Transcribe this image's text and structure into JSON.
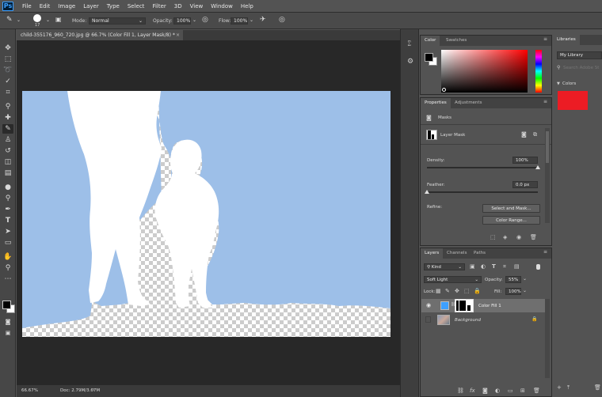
{
  "menubar": {
    "logo": "Ps",
    "items": [
      "File",
      "Edit",
      "Image",
      "Layer",
      "Type",
      "Select",
      "Filter",
      "3D",
      "View",
      "Window",
      "Help"
    ]
  },
  "options": {
    "brush_size": "17",
    "mode_label": "Mode:",
    "mode_value": "Normal",
    "opacity_label": "Opacity:",
    "opacity_value": "100%",
    "flow_label": "Flow:",
    "flow_value": "100%"
  },
  "document": {
    "tab_title": "child-355176_960_720.jpg @ 66.7% (Color Fill 1, Layer Mask/8) *",
    "close_glyph": "×",
    "zoom": "66.67%",
    "doc_size": "Doc: 2.79M/3.67M"
  },
  "color_panel": {
    "tabs": [
      "Color",
      "Swatches"
    ],
    "foreground": "#000000",
    "background": "#ffffff",
    "hue": "#ff0000"
  },
  "properties_panel": {
    "tabs": [
      "Properties",
      "Adjustments"
    ],
    "section": "Masks",
    "mask_name": "Layer Mask",
    "density_label": "Density:",
    "density_value": "100%",
    "density_level": 1.0,
    "feather_label": "Feather:",
    "feather_value": "0.0 px",
    "feather_level": 0.0,
    "refine_label": "Refine:",
    "select_mask_button": "Select and Mask...",
    "color_range_button": "Color Range..."
  },
  "layers_panel": {
    "tabs": [
      "Layers",
      "Channels",
      "Paths"
    ],
    "filter_kind": "Kind",
    "blend_mode": "Soft Light",
    "opacity_label": "Opacity:",
    "opacity_value": "55%",
    "lock_label": "Lock:",
    "fill_label": "Fill:",
    "fill_value": "100%",
    "layers": [
      {
        "name": "Color Fill 1",
        "visible": true,
        "selected": true
      },
      {
        "name": "Background",
        "visible": false,
        "selected": false,
        "locked": true
      }
    ]
  },
  "libraries_panel": {
    "title": "Libraries",
    "library_name": "My Library",
    "search_placeholder": "Search Adobe St",
    "colors_label": "Colors",
    "swatch_color": "#ec1c24"
  },
  "colors": {
    "fill_blue": "#9dbfe8",
    "accent_blue": "#3ea0ff"
  }
}
